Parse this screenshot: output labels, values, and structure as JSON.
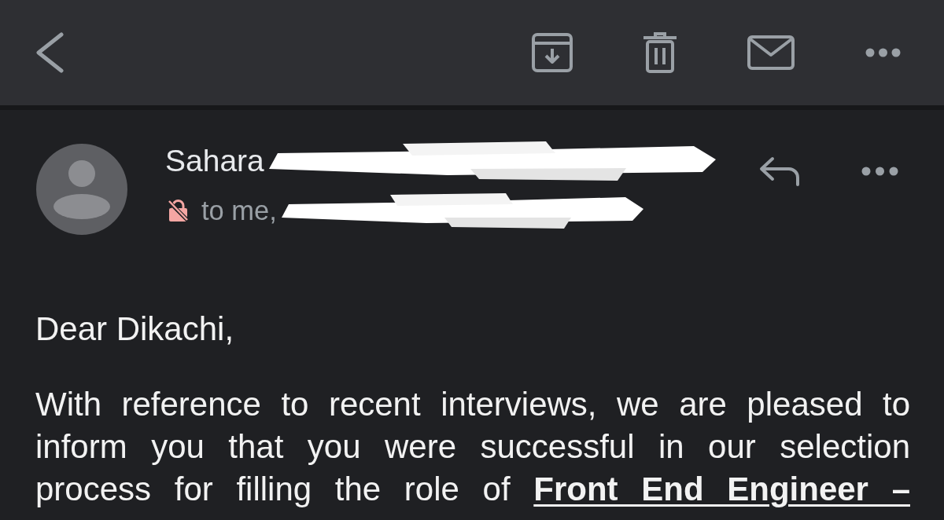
{
  "message": {
    "sender": {
      "name": "Sahara",
      "redacted": true
    },
    "recipients": {
      "label": "to me,",
      "redacted": true
    },
    "greeting": "Dear Dikachi,",
    "paragraphs": [
      "With reference to recent interviews, we are pleased to inform you that you were successful in our selection process for filling the role of **Front End Engineer –**"
    ]
  }
}
